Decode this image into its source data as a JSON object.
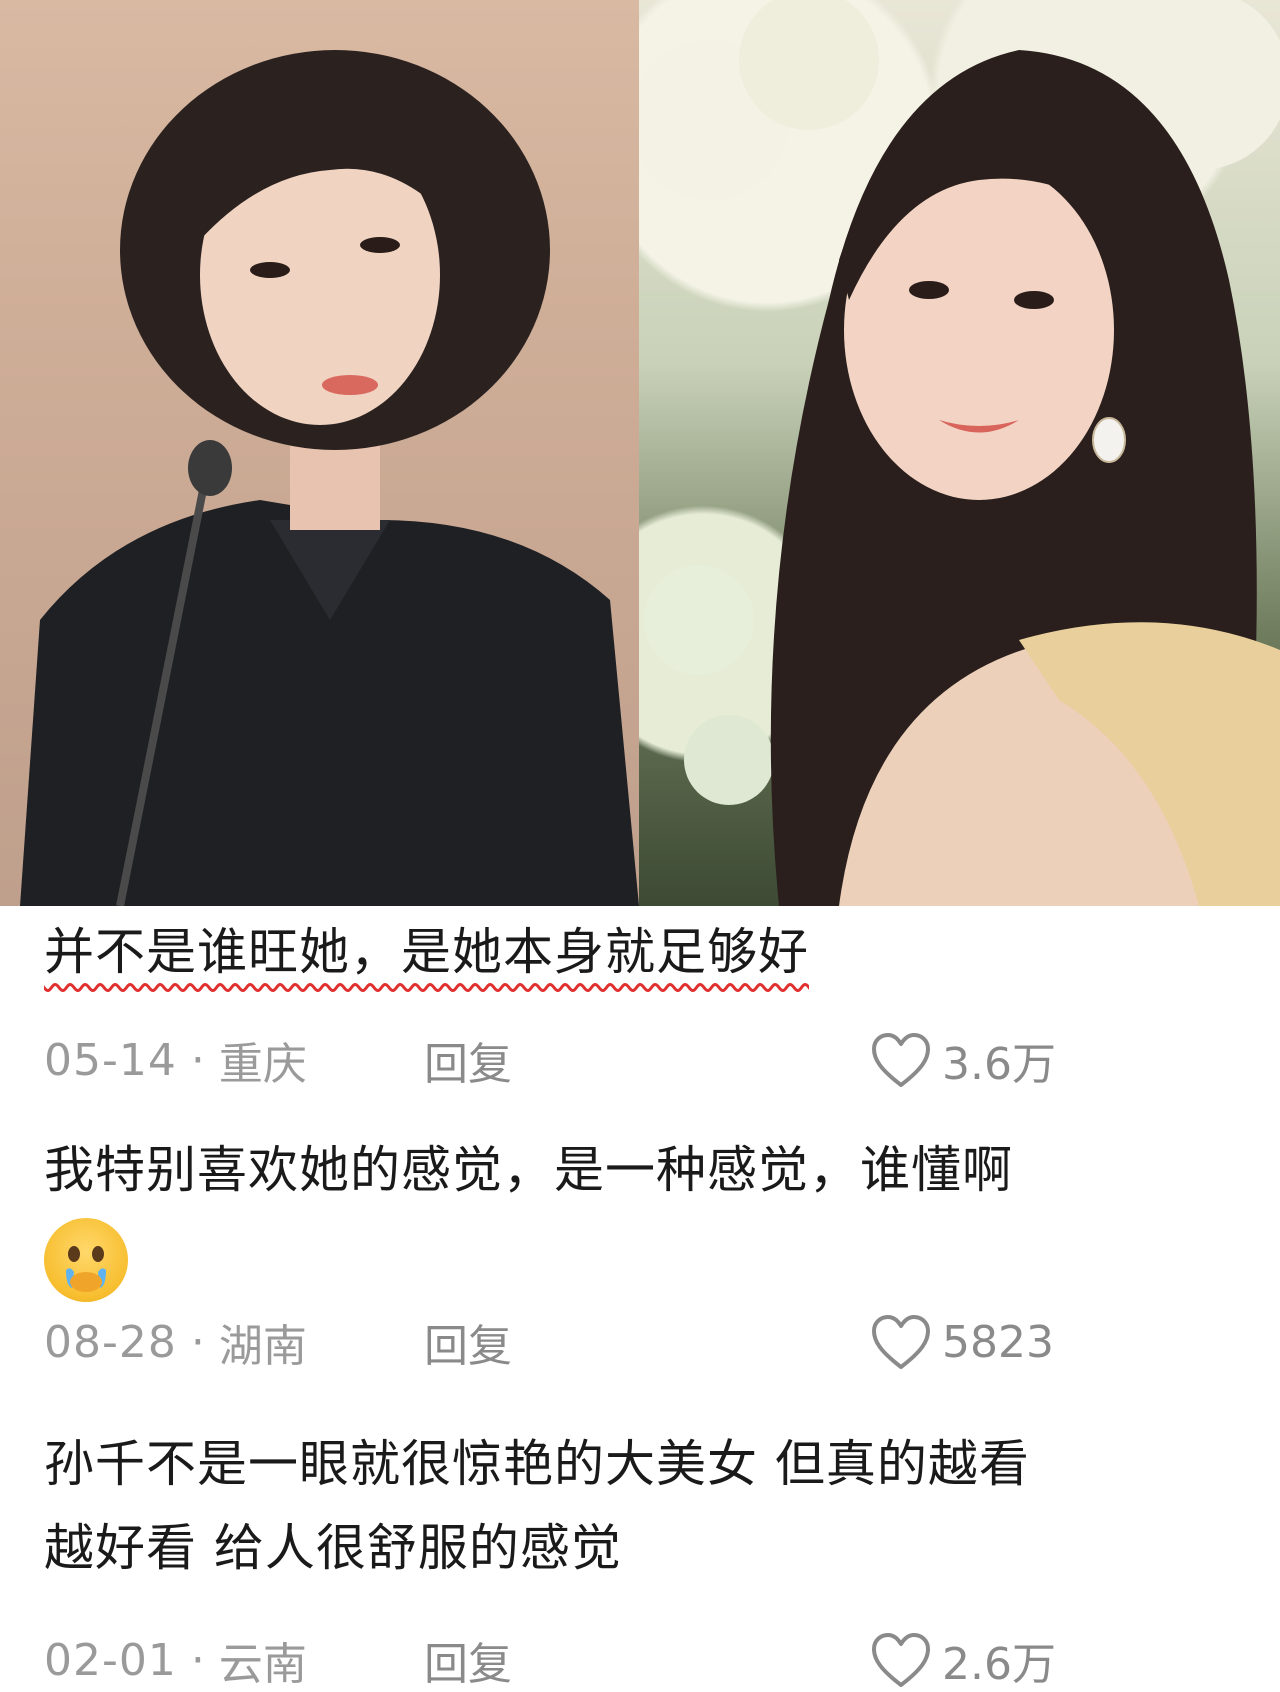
{
  "photos": [
    {
      "name": "left-photo"
    },
    {
      "name": "right-photo"
    }
  ],
  "comments": [
    {
      "text": "并不是谁旺她，是她本身就足够好",
      "date": "05-14",
      "separator": "·",
      "location": "重庆",
      "reply_label": "回复",
      "likes": "3.6万",
      "highlighted": true
    },
    {
      "text": "我特别喜欢她的感觉，是一种感觉，谁懂啊",
      "emoji": "crying-face-emoji",
      "date": "08-28",
      "separator": "·",
      "location": "湖南",
      "reply_label": "回复",
      "likes": "5823"
    },
    {
      "text_line1": "孙千不是一眼就很惊艳的大美女 但真的越看",
      "text_line2": "越好看 给人很舒服的感觉",
      "date": "02-01",
      "separator": "·",
      "location": "云南",
      "reply_label": "回复",
      "likes": "2.6万"
    }
  ],
  "colors": {
    "underline": "#e03030",
    "meta_gray": "#9a9a9a",
    "text": "#1a1a1a"
  }
}
